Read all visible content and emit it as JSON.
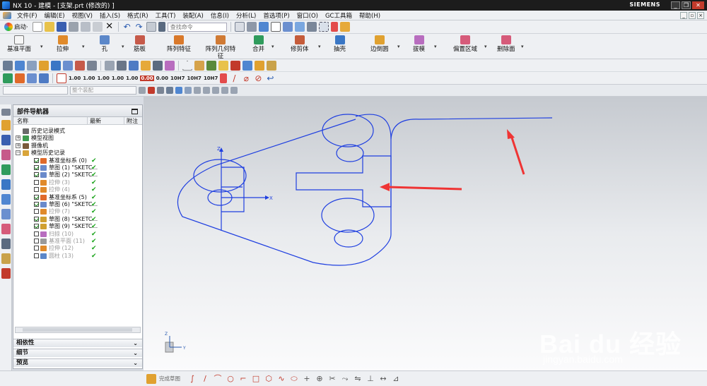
{
  "window": {
    "title": "NX 10 - 建模 - [支架.prt  (修改的) ]",
    "brand": "SIEMENS",
    "min_label": "_",
    "restore_label": "❐",
    "close_label": "✕"
  },
  "menubar": {
    "items": [
      "文件(F)",
      "编辑(E)",
      "视图(V)",
      "插入(S)",
      "格式(R)",
      "工具(T)",
      "装配(A)",
      "信息(I)",
      "分析(L)",
      "首选项(P)",
      "窗口(O)",
      "GC工具箱",
      "帮助(H)"
    ]
  },
  "toolbar1": {
    "start_label": "启动·",
    "search_placeholder": "查找命令"
  },
  "ribbon": {
    "buttons": [
      {
        "label": "基准平面",
        "color": "#f0f0f0"
      },
      {
        "label": "拉伸",
        "color": "#e08a2a"
      },
      {
        "label": "孔",
        "color": "#5b87c9"
      },
      {
        "label": "筋板",
        "color": "#c65a4a"
      },
      {
        "label": "阵列特征",
        "color": "#d9792b"
      },
      {
        "label": "阵列几何特\n征",
        "color": "#d07a34"
      },
      {
        "label": "合并",
        "color": "#2f9b5c"
      },
      {
        "label": "修剪体",
        "color": "#c55c3a"
      },
      {
        "label": "抽壳",
        "color": "#3a77c5"
      },
      {
        "label": "边倒圆",
        "color": "#e0a130"
      },
      {
        "label": "拔模",
        "color": "#b86dbf"
      },
      {
        "label": "偏置区域",
        "color": "#d65b7a"
      },
      {
        "label": "删除面",
        "color": "#d65b7a"
      }
    ]
  },
  "toolbar4": {
    "numbers": [
      "1.00",
      "1.00",
      "1.00",
      "1.00",
      "1.00",
      "0.00",
      "0.00",
      "10H7",
      "10H7",
      "10H7"
    ]
  },
  "toolbar5": {
    "filter_placeholder": "整个装配"
  },
  "navigator": {
    "title": "部件导航器",
    "columns": {
      "name": "名称",
      "latest": "最新",
      "notes": "附注"
    },
    "rows": [
      {
        "indent": 0,
        "expander": "",
        "checkbox": false,
        "label": "历史记录模式",
        "off": false,
        "check": false,
        "icon": "#6a6a6a"
      },
      {
        "indent": 0,
        "expander": "+",
        "checkbox": false,
        "label": "模型视图",
        "off": false,
        "check": false,
        "icon": "#3f9b4f"
      },
      {
        "indent": 0,
        "expander": "+",
        "checkbox": false,
        "label": "摄像机",
        "off": false,
        "check": false,
        "icon": "#7a5a3a"
      },
      {
        "indent": 0,
        "expander": "−",
        "checkbox": false,
        "label": "模型历史记录",
        "off": false,
        "check": false,
        "icon": "#d9a53a"
      },
      {
        "indent": 1,
        "expander": "",
        "checkbox": true,
        "label": "基准坐标系 (0)",
        "off": false,
        "check": true,
        "icon": "#e06a2a"
      },
      {
        "indent": 1,
        "expander": "",
        "checkbox": true,
        "label": "草图 (1) \"SKETC...",
        "off": false,
        "check": true,
        "icon": "#6a8acb"
      },
      {
        "indent": 1,
        "expander": "",
        "checkbox": true,
        "label": "草图 (2) \"SKETC...",
        "off": false,
        "check": true,
        "icon": "#6a8acb"
      },
      {
        "indent": 1,
        "expander": "",
        "checkbox": false,
        "label": "拉伸 (3)",
        "off": true,
        "check": true,
        "icon": "#e08a2a"
      },
      {
        "indent": 1,
        "expander": "",
        "checkbox": false,
        "label": "拉伸 (4)",
        "off": true,
        "check": true,
        "icon": "#e08a2a"
      },
      {
        "indent": 1,
        "expander": "",
        "checkbox": true,
        "label": "基准坐标系 (5)",
        "off": false,
        "check": true,
        "icon": "#e06a2a"
      },
      {
        "indent": 1,
        "expander": "",
        "checkbox": true,
        "label": "草图 (6) \"SKETC...",
        "off": false,
        "check": true,
        "icon": "#6a8acb"
      },
      {
        "indent": 1,
        "expander": "",
        "checkbox": false,
        "label": "拉伸 (7)",
        "off": true,
        "check": true,
        "icon": "#e08a2a"
      },
      {
        "indent": 1,
        "expander": "",
        "checkbox": true,
        "label": "草图 (8) \"SKETC...",
        "off": false,
        "check": true,
        "icon": "#d0a030"
      },
      {
        "indent": 1,
        "expander": "",
        "checkbox": true,
        "label": "草图 (9) \"SKETC...",
        "off": false,
        "check": true,
        "icon": "#d0a030"
      },
      {
        "indent": 1,
        "expander": "",
        "checkbox": false,
        "label": "扫掠 (10)",
        "off": true,
        "check": true,
        "icon": "#b86dbf"
      },
      {
        "indent": 1,
        "expander": "",
        "checkbox": false,
        "label": "基准平面 (11)",
        "off": true,
        "check": true,
        "icon": "#9a9a9a"
      },
      {
        "indent": 1,
        "expander": "",
        "checkbox": false,
        "label": "拉伸 (12)",
        "off": true,
        "check": true,
        "icon": "#e08a2a"
      },
      {
        "indent": 1,
        "expander": "",
        "checkbox": false,
        "label": "圆柱 (13)",
        "off": true,
        "check": true,
        "icon": "#5b87c9"
      }
    ],
    "sections": [
      "相依性",
      "细节",
      "预览"
    ]
  },
  "graphics": {
    "sketch_color": "#1f3fe0",
    "arrow_color": "#ef3434",
    "watermark_brand": "Bai du 经验",
    "watermark_url": "jingyan.baidu.com",
    "triad_labels": {
      "x": "X",
      "y": "Y",
      "z": "Z"
    }
  },
  "bottombar": {
    "finish_label": "完成草图"
  }
}
